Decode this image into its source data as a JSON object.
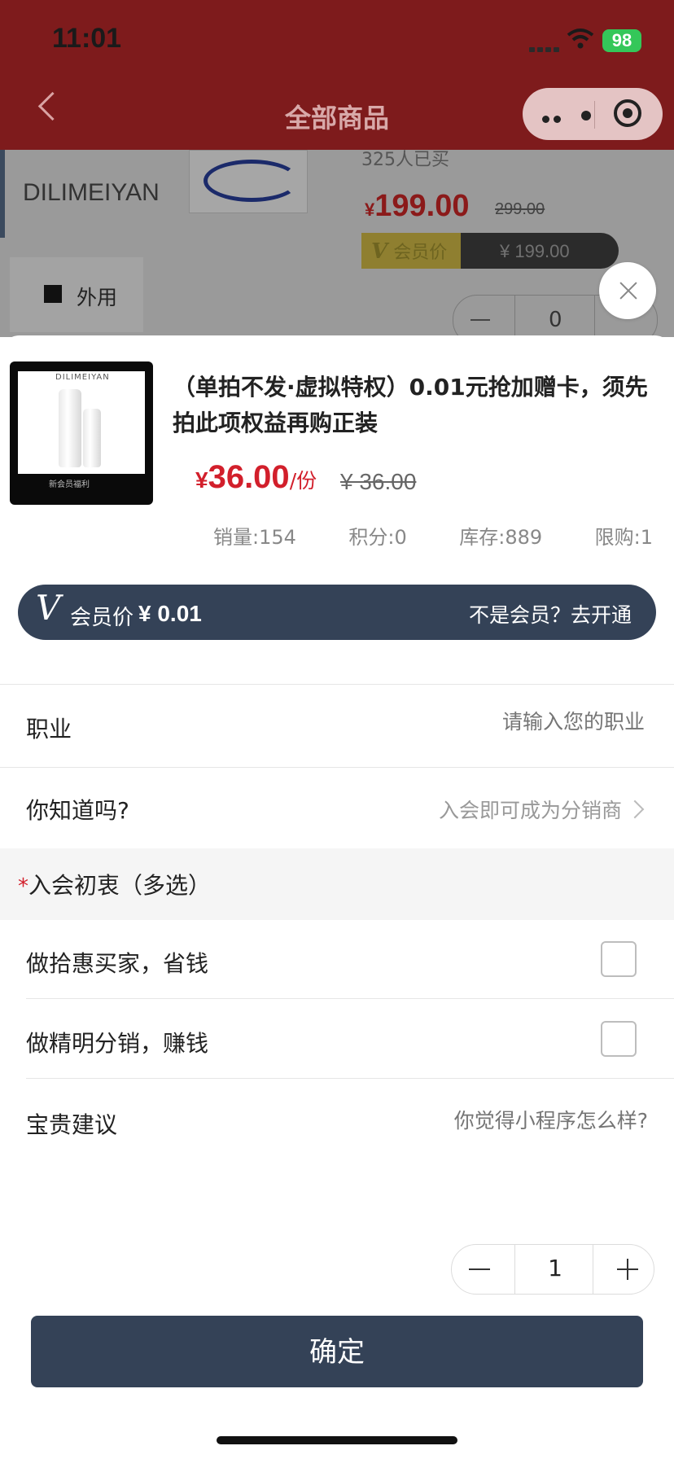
{
  "status_bar": {
    "time": "11:01",
    "battery": "98"
  },
  "nav": {
    "title": "全部商品"
  },
  "background_page": {
    "brand": "DILIMEIYAN",
    "sold": "325人已买",
    "price_currency": "¥",
    "price": "199.00",
    "original_price": "299.00",
    "vip_label": "会员价",
    "vip_price": "¥ 199.00",
    "tag": "外用",
    "qty": "0"
  },
  "product": {
    "image_brand": "DILIMEIYAN",
    "image_caption": "新会员福利",
    "title": "（单拍不发·虚拟特权）0.01元抢加赠卡，须先拍此项权益再购正装",
    "price_currency": "¥",
    "price": "36.00",
    "unit": "/份",
    "original_price": "¥ 36.00",
    "stats": {
      "sales": "销量:154",
      "points": "积分:0",
      "stock": "库存:889",
      "limit": "限购:1"
    }
  },
  "vip_bar": {
    "v": "V",
    "label": "会员价",
    "price": "¥ 0.01",
    "join": "不是会员？去开通"
  },
  "form": {
    "occupation": {
      "label": "职业",
      "placeholder": "请输入您的职业"
    },
    "did_you_know": {
      "label": "你知道吗?",
      "value": "入会即可成为分销商"
    },
    "intent_section": {
      "required_mark": "*",
      "title": "入会初衷（多选）"
    },
    "options": [
      {
        "label": "做拾惠买家，省钱",
        "checked": false
      },
      {
        "label": "做精明分销，赚钱",
        "checked": false
      }
    ],
    "suggestion": {
      "label": "宝贵建议",
      "placeholder": "你觉得小程序怎么样?"
    }
  },
  "quantity": {
    "value": "1"
  },
  "confirm_button": {
    "label": "确定"
  },
  "colors": {
    "nav_bg": "#7e1b1c",
    "price_red": "#d21f2b",
    "vip_navy": "#344257"
  }
}
